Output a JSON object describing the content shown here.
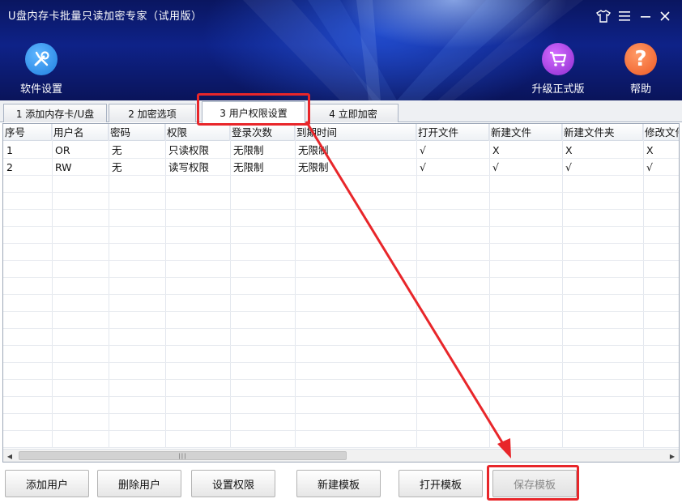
{
  "window": {
    "title": "U盘内存卡批量只读加密专家（试用版）"
  },
  "header": {
    "settings_label": "软件设置",
    "upgrade_label": "升级正式版",
    "help_label": "帮助",
    "help_glyph": "?"
  },
  "tabs": [
    {
      "label": "1 添加内存卡/U盘"
    },
    {
      "label": "2 加密选项"
    },
    {
      "label": "3 用户权限设置"
    },
    {
      "label": "4 立即加密"
    }
  ],
  "table": {
    "columns": [
      "序号",
      "用户名",
      "密码",
      "权限",
      "登录次数",
      "到期时间",
      "打开文件",
      "新建文件",
      "新建文件夹",
      "修改文件"
    ],
    "rows": [
      [
        "1",
        "OR",
        "无",
        "只读权限",
        "无限制",
        "无限制",
        "√",
        "X",
        "X",
        "X"
      ],
      [
        "2",
        "RW",
        "无",
        "读写权限",
        "无限制",
        "无限制",
        "√",
        "√",
        "√",
        "√"
      ]
    ]
  },
  "scrollbar": {
    "left_arrow": "◀",
    "right_arrow": "▶",
    "thumb_grip": "|||"
  },
  "buttons": {
    "add_user": "添加用户",
    "delete_user": "删除用户",
    "set_permission": "设置权限",
    "new_template": "新建模板",
    "open_template": "打开模板",
    "save_template": "保存模板"
  },
  "colors": {
    "header_bg": "#0e2288",
    "settings_circle": "#2b8ee8",
    "upgrade_circle": "#9a3bd6",
    "help_circle": "#f06a35",
    "highlight_red": "#e8262a"
  }
}
